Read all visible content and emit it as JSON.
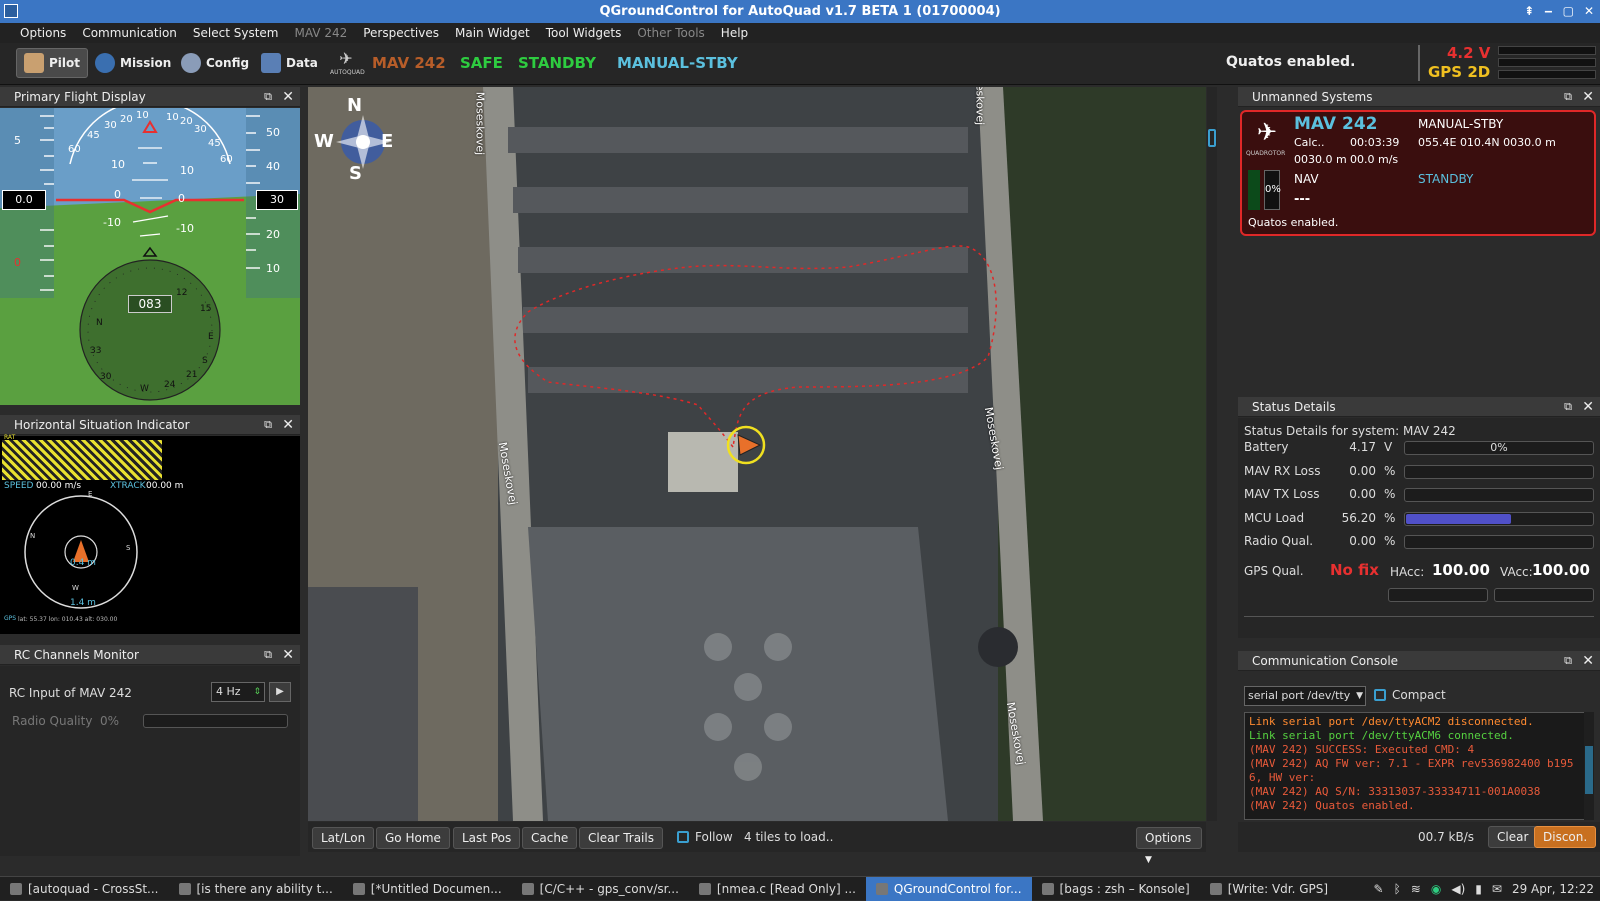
{
  "window": {
    "title": "QGroundControl for AutoQuad v1.7 BETA 1 (01700004)"
  },
  "menu": [
    "Options",
    "Communication",
    "Select System",
    "MAV 242",
    "Perspectives",
    "Main Widget",
    "Tool Widgets",
    "Other Tools",
    "Help"
  ],
  "toolbar": {
    "pilot": "Pilot",
    "mission": "Mission",
    "config": "Config",
    "data": "Data",
    "mav": "MAV 242",
    "safe": "SAFE",
    "standby": "STANDBY",
    "mode": "MANUAL-STBY",
    "status_msg": "Quatos enabled.",
    "voltage": "4.2 V",
    "gps": "GPS 2D",
    "logo_text": "AUTOQUAD",
    "colors": {
      "mav": "#e8702a",
      "safe": "#2ecc40",
      "standby": "#2ecc40",
      "mode": "#5bc0de",
      "voltage": "#e83030",
      "gps": "#f0c020"
    }
  },
  "pfd": {
    "title": "Primary Flight Display",
    "roll_scale": [
      "60",
      "45",
      "30",
      "20",
      "10",
      "10",
      "20",
      "30",
      "45",
      "60"
    ],
    "pitch_labels": [
      "10",
      "10",
      "0",
      "0",
      "-10",
      "-10"
    ],
    "altitude_box": "0.0",
    "speed_box": "30",
    "left_tape": [
      "5",
      "0"
    ],
    "right_tape": [
      "50",
      "40",
      "30",
      "20",
      "10"
    ],
    "heading": "083",
    "compass_labels": [
      "N",
      "E",
      "S",
      "W",
      "12",
      "15",
      "21",
      "24",
      "30",
      "33"
    ]
  },
  "hsi": {
    "title": "Horizontal Situation Indicator",
    "speed_label": "SPEED",
    "speed_value": "00.00 m/s",
    "xtrack_label": "XTRACK",
    "xtrack_value": "00.00 m",
    "inner_dist": "0.4 m",
    "outer_dist": "1.4 m",
    "gps_line": "lat: 55.37 lon: 010.43 alt: 030.00",
    "compass": [
      "E",
      "N",
      "S",
      "W"
    ],
    "status_tags": [
      "GPS",
      "RAT"
    ]
  },
  "rc": {
    "title": "RC Channels Monitor",
    "input_label": "RC Input of MAV 242",
    "rate": "4 Hz",
    "quality_label": "Radio Quality",
    "quality_value": "0%"
  },
  "map": {
    "compass": [
      "N",
      "E",
      "S",
      "W"
    ],
    "streets": [
      "Moseskovej",
      "Moseskovej",
      "Moseskovej",
      "Moseskovej",
      "Moseskovej"
    ],
    "buttons": [
      "Lat/Lon",
      "Go Home",
      "Last Pos",
      "Cache",
      "Clear Trails"
    ],
    "follow_label": "Follow",
    "tiles_msg": "4 tiles to load..",
    "options": "Options"
  },
  "uas": {
    "title": "Unmanned Systems",
    "name": "MAV 242",
    "mode": "MANUAL-STBY",
    "calc": "Calc..",
    "time": "00:03:39",
    "position": "055.4E 010.4N 0030.0 m",
    "alt": "0030.0 m",
    "speed": "00.0 m/s",
    "battery": "0%",
    "nav": "NAV",
    "state": "STANDBY",
    "dashes": "---",
    "message": "Quatos enabled.",
    "airframe": "QUADROTOR"
  },
  "status": {
    "title": "Status Details",
    "header": "Status Details for system: MAV 242",
    "rows": [
      {
        "label": "Battery",
        "value": "4.17",
        "unit": "V",
        "bar": "0%",
        "fill": 0.0
      },
      {
        "label": "MAV RX Loss",
        "value": "0.00",
        "unit": "%",
        "bar": "",
        "fill": 0.0
      },
      {
        "label": "MAV TX Loss",
        "value": "0.00",
        "unit": "%",
        "bar": "",
        "fill": 0.0
      },
      {
        "label": "MCU Load",
        "value": "56.20",
        "unit": "%",
        "bar": "",
        "fill": 0.562
      },
      {
        "label": "Radio Qual.",
        "value": "0.00",
        "unit": "%",
        "bar": "",
        "fill": 0.0
      }
    ],
    "gps_label": "GPS Qual.",
    "gps_fix": "No fix",
    "hacc_label": "HAcc:",
    "hacc": "100.00",
    "vacc_label": "VAcc:",
    "vacc": "100.00"
  },
  "console": {
    "title": "Communication Console",
    "port": "serial port /dev/tty",
    "compact": "Compact",
    "lines": [
      {
        "text": "Link serial port /dev/ttyACM2 disconnected.",
        "color": "#ff8a30"
      },
      {
        "text": "Link serial port /dev/ttyACM6 connected.",
        "color": "#55d040"
      },
      {
        "text": "(MAV 242) SUCCESS: Executed CMD: 4",
        "color": "#e85a3a"
      },
      {
        "text": "(MAV 242) AQ FW ver: 7.1 - EXPR rev536982400 b195",
        "color": "#e85a3a"
      },
      {
        "text": "6, HW ver:",
        "color": "#e85a3a"
      },
      {
        "text": "(MAV 242) AQ S/N: 33313037-33334711-001A0038",
        "color": "#e85a3a"
      },
      {
        "text": "(MAV 242) Quatos enabled.",
        "color": "#e85a3a"
      }
    ],
    "rate": "00.7 kB/s",
    "clear": "Clear",
    "disconnect": "Discon."
  },
  "taskbar": {
    "tasks": [
      "[autoquad - CrossSt...",
      "[is there any ability t...",
      "[*Untitled Documen...",
      "[C/C++ - gps_conv/sr...",
      "[nmea.c [Read Only] ...",
      "QGroundControl for...",
      "[bags : zsh – Konsole]",
      "[Write: Vdr. GPS]"
    ],
    "active_index": 5,
    "clock": "29 Apr, 12:22"
  }
}
